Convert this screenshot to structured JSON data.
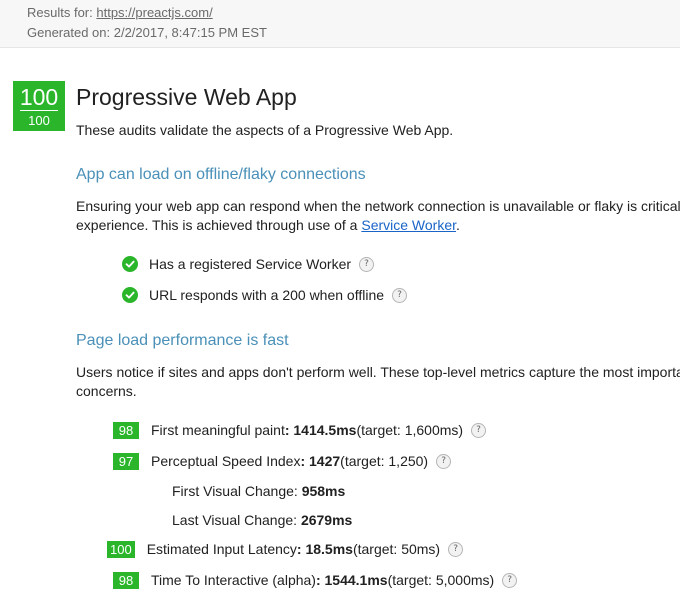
{
  "header": {
    "results_label": "Results for: ",
    "url": "https://preactjs.com/",
    "generated": "Generated on: 2/2/2017, 8:47:15 PM EST"
  },
  "category": {
    "score": "100",
    "score_small": "100",
    "title": "Progressive Web App",
    "description": "These audits validate the aspects of a Progressive Web App."
  },
  "section_offline": {
    "heading": "App can load on offline/flaky connections",
    "para_line1": "Ensuring your web app can respond when the network connection is unavailable or flaky is critical to providing a good",
    "para_line2_before": "experience. This is achieved through use of a ",
    "para_link": "Service Worker",
    "para_line2_after": ".",
    "audits": [
      {
        "label": "Has a registered Service Worker"
      },
      {
        "label": "URL responds with a 200 when offline"
      }
    ]
  },
  "section_perf": {
    "heading": "Page load performance is fast",
    "para_line1": "Users notice if sites and apps don't perform well. These top-level metrics capture the most important perceived performance",
    "para_line2": "concerns.",
    "metrics": [
      {
        "score": "98",
        "label": "First meaningful paint",
        "value": ": 1414.5ms",
        "target": " (target: 1,600ms)"
      },
      {
        "score": "97",
        "label": "Perceptual Speed Index",
        "value": ": 1427",
        "target": " (target: 1,250)"
      },
      {
        "score": "100",
        "label": "Estimated Input Latency",
        "value": ": 18.5ms",
        "target": " (target: 50ms)"
      },
      {
        "score": "98",
        "label": "Time To Interactive (alpha)",
        "value": ": 1544.1ms",
        "target": " (target: 5,000ms)"
      }
    ],
    "sub_metrics": [
      {
        "label": "First Visual Change: ",
        "value": "958ms"
      },
      {
        "label": "Last Visual Change: ",
        "value": "2679ms"
      }
    ]
  },
  "help_glyph": "?",
  "colors": {
    "pass_green": "#2bb52b",
    "section_blue": "#4a90b8",
    "link_blue": "#1a64c8"
  }
}
